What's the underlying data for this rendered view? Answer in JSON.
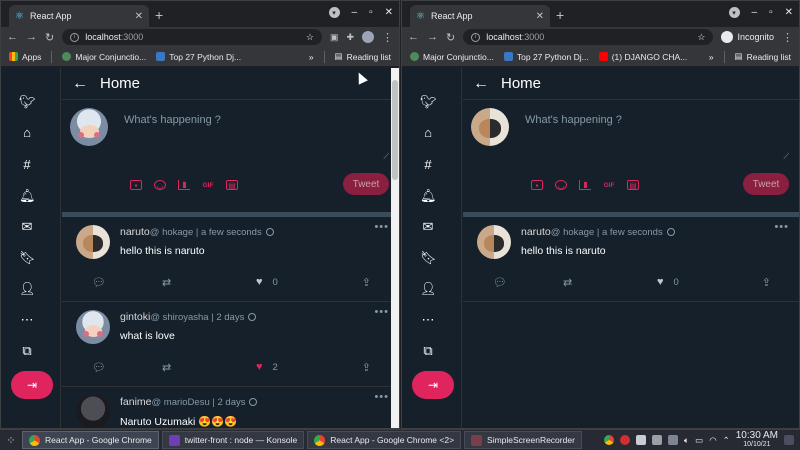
{
  "left_window": {
    "tab": {
      "title": "React App"
    },
    "url": {
      "host": "localhost",
      "port": ":3000"
    },
    "bookmarks": [
      "Apps",
      "Major Conjunctio...",
      "Top 27 Python Dj..."
    ],
    "reading_list": "Reading list"
  },
  "right_window": {
    "tab": {
      "title": "React App"
    },
    "url": {
      "host": "localhost",
      "port": ":3000"
    },
    "incognito_label": "Incognito",
    "bookmarks": [
      "Major Conjunctio...",
      "Top 27 Python Dj...",
      "(1) DJANGO CHA..."
    ],
    "reading_list": "Reading list"
  },
  "app": {
    "page_title": "Home",
    "composer_placeholder": "What's happening ?",
    "tweet_button": "Tweet",
    "gif_label": "GIF",
    "colors": {
      "accent": "#e0245e",
      "background": "#15202b",
      "border": "#2f3336"
    }
  },
  "feed_left": [
    {
      "name": "naruto",
      "handle": "@ hokage",
      "time": "| a few seconds",
      "text": "hello this is naruto",
      "likes": "0",
      "liked": false
    },
    {
      "name": "gintoki",
      "handle": "@ shiroyasha",
      "time": "| 2 days",
      "text": "what is love",
      "likes": "2",
      "liked": true
    },
    {
      "name": "fanime",
      "handle": "@ marioDesu",
      "time": "| 2 days",
      "text": "Naruto Uzumaki 😍😍😍"
    }
  ],
  "feed_right": [
    {
      "name": "naruto",
      "handle": "@ hokage",
      "time": "| a few seconds",
      "text": "hello this is naruto",
      "likes": "0",
      "liked": false
    }
  ],
  "taskbar": {
    "tasks": [
      "React App - Google Chrome",
      "twitter-front : node — Konsole",
      "React App - Google Chrome <2>",
      "SimpleScreenRecorder"
    ],
    "time": "10:30 AM",
    "date": "10/10/21"
  }
}
